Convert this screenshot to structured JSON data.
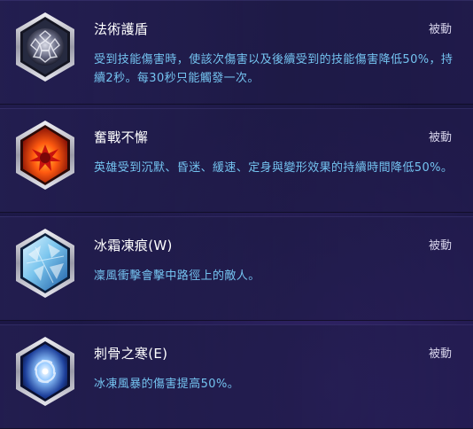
{
  "talents": [
    {
      "icon": "hexagon-sphere-icon",
      "name": "法術護盾",
      "type": "被動",
      "description": "受到技能傷害時，使該次傷害以及後續受到的技能傷害降低50%，持續2秒。每30秒只能觸發一次。"
    },
    {
      "icon": "red-burst-icon",
      "name": "奮戰不懈",
      "type": "被動",
      "description": "英雄受到沉默、昏迷、緩速、定身與變形效果的持續時間降低50%。"
    },
    {
      "icon": "ice-shard-icon",
      "name": "冰霜凍痕(W)",
      "type": "被動",
      "description": "凜風衝擊會擊中路徑上的敵人。"
    },
    {
      "icon": "frost-vortex-icon",
      "name": "刺骨之寒(E)",
      "type": "被動",
      "description": "冰凍風暴的傷害提高50%。"
    }
  ]
}
